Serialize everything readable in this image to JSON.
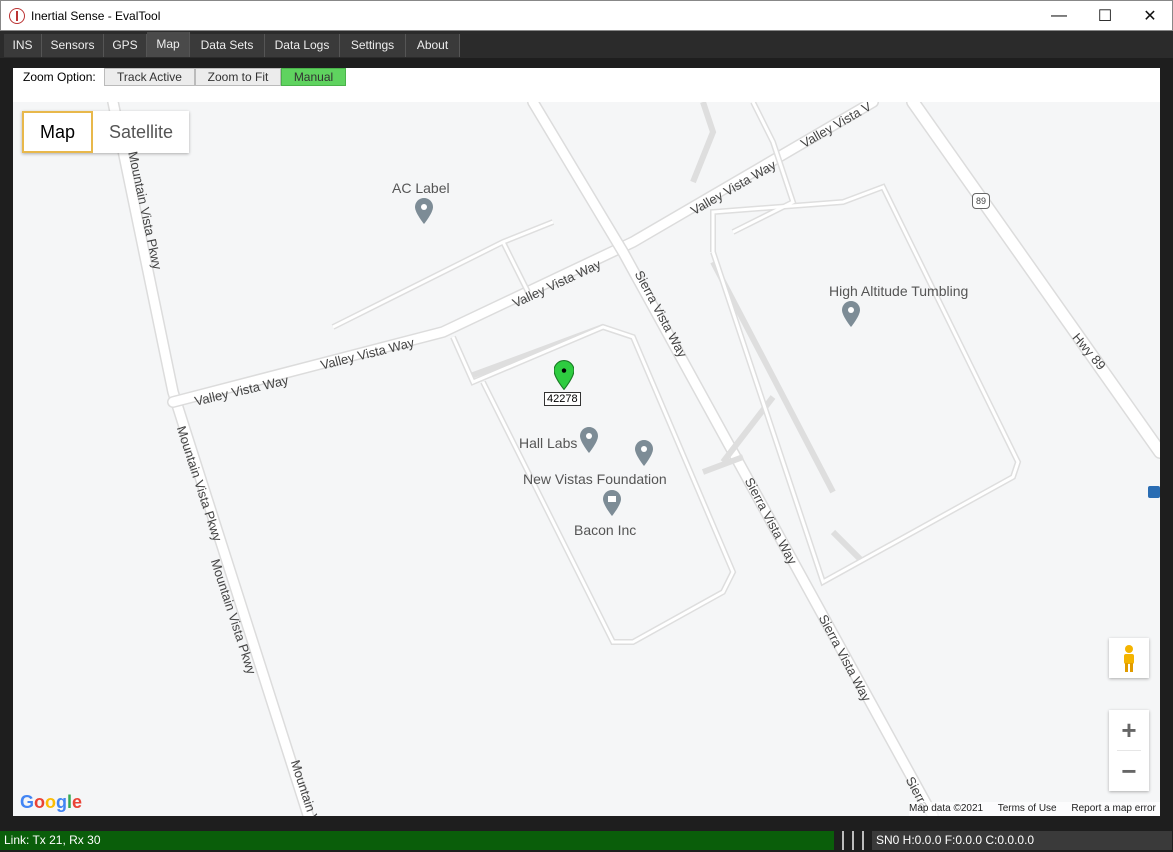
{
  "window": {
    "title": "Inertial Sense - EvalTool",
    "minimize": "—",
    "maximize": "☐",
    "close": "✕"
  },
  "tabs": [
    {
      "label": "INS"
    },
    {
      "label": "Sensors"
    },
    {
      "label": "GPS"
    },
    {
      "label": "Map"
    },
    {
      "label": "Data Sets"
    },
    {
      "label": "Data Logs"
    },
    {
      "label": "Settings"
    },
    {
      "label": "About"
    }
  ],
  "active_tab": "Map",
  "zoom": {
    "label": "Zoom Option:",
    "options": [
      {
        "label": "Track Active"
      },
      {
        "label": "Zoom to Fit"
      },
      {
        "label": "Manual"
      }
    ],
    "selected": "Manual"
  },
  "map": {
    "type_buttons": [
      {
        "label": "Map"
      },
      {
        "label": "Satellite"
      }
    ],
    "selected_type": "Map",
    "places": [
      {
        "name": "AC Label"
      },
      {
        "name": "High Altitude Tumbling"
      },
      {
        "name": "Hall Labs"
      },
      {
        "name": "New Vistas Foundation"
      },
      {
        "name": "Bacon Inc"
      }
    ],
    "roads": {
      "valley_vista": "Valley Vista Way",
      "mountain_vista": "Mountain Vista Pkwy",
      "mountain_short": "Mountain V",
      "sierra_vista": "Sierra Vista Way",
      "sierra_short": "Sierra",
      "hwy89": "Hwy 89",
      "valley_short": "Valley Vista V",
      "shield": "89"
    },
    "marker": {
      "label": "42278",
      "color": "#2ecc40"
    },
    "zoom_in": "+",
    "zoom_out": "−",
    "google": "Google",
    "attribution": {
      "data": "Map data ©2021",
      "terms": "Terms of Use",
      "report": "Report a map error"
    }
  },
  "status": {
    "link": "Link: Tx 21, Rx 30",
    "info": "SN0  H:0.0.0  F:0.0.0  C:0.0.0.0"
  },
  "colors": {
    "link_bg": "#0a5e0a",
    "manual_on": "#5fd35f",
    "selected_border": "#e8b84b"
  }
}
